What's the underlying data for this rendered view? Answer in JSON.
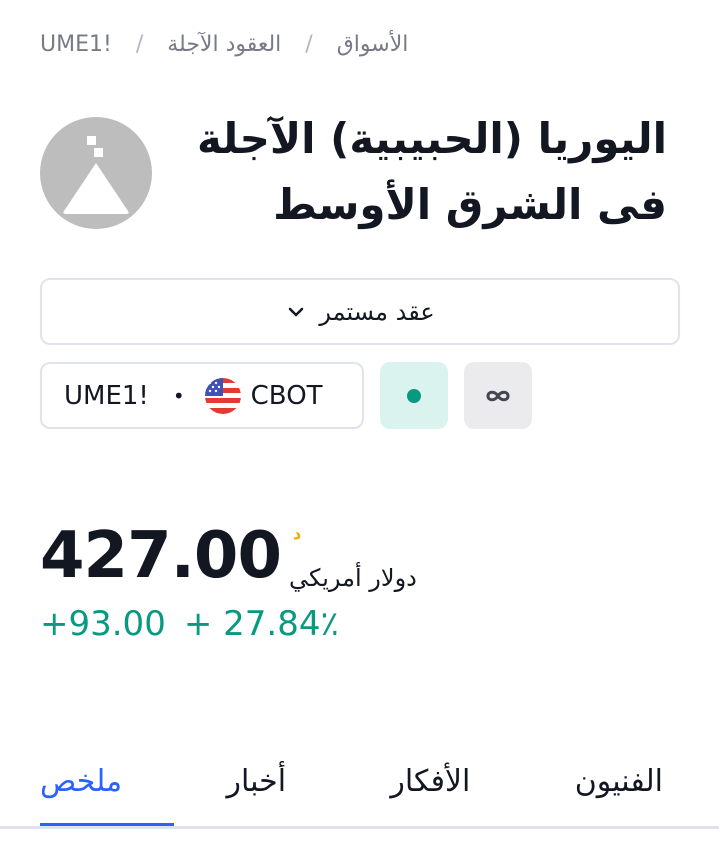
{
  "breadcrumb": {
    "items": [
      "الأسواق",
      "العقود الآجلة",
      "UME1!"
    ]
  },
  "title": "اليوريا (الحبيبية) الآجلة فى الشرق الأوسط",
  "contract_select": {
    "label": "عقد مستمر"
  },
  "symbol": {
    "ticker": "UME1!",
    "separator": "•",
    "exchange": "CBOT"
  },
  "price": {
    "value": "427.00",
    "marker": "د",
    "currency": "دولار أمريكي"
  },
  "change": {
    "absolute": "+93.00",
    "percent": "+ 27.84٪"
  },
  "tabs": [
    {
      "label": "ملخص",
      "active": true
    },
    {
      "label": "أخبار",
      "active": false
    },
    {
      "label": "الأفكار",
      "active": false
    },
    {
      "label": "الفنيون",
      "active": false
    }
  ],
  "colors": {
    "accent": "#2962ff",
    "positive": "#089981",
    "marker": "#f7a600",
    "logo_bg": "#bdbdbd"
  },
  "icons": {
    "logo": "warning-triangle-icon",
    "chevron": "chevron-down-icon",
    "flag": "us-flag-icon",
    "status": "market-open-dot-icon",
    "infinity": "infinity-icon"
  }
}
